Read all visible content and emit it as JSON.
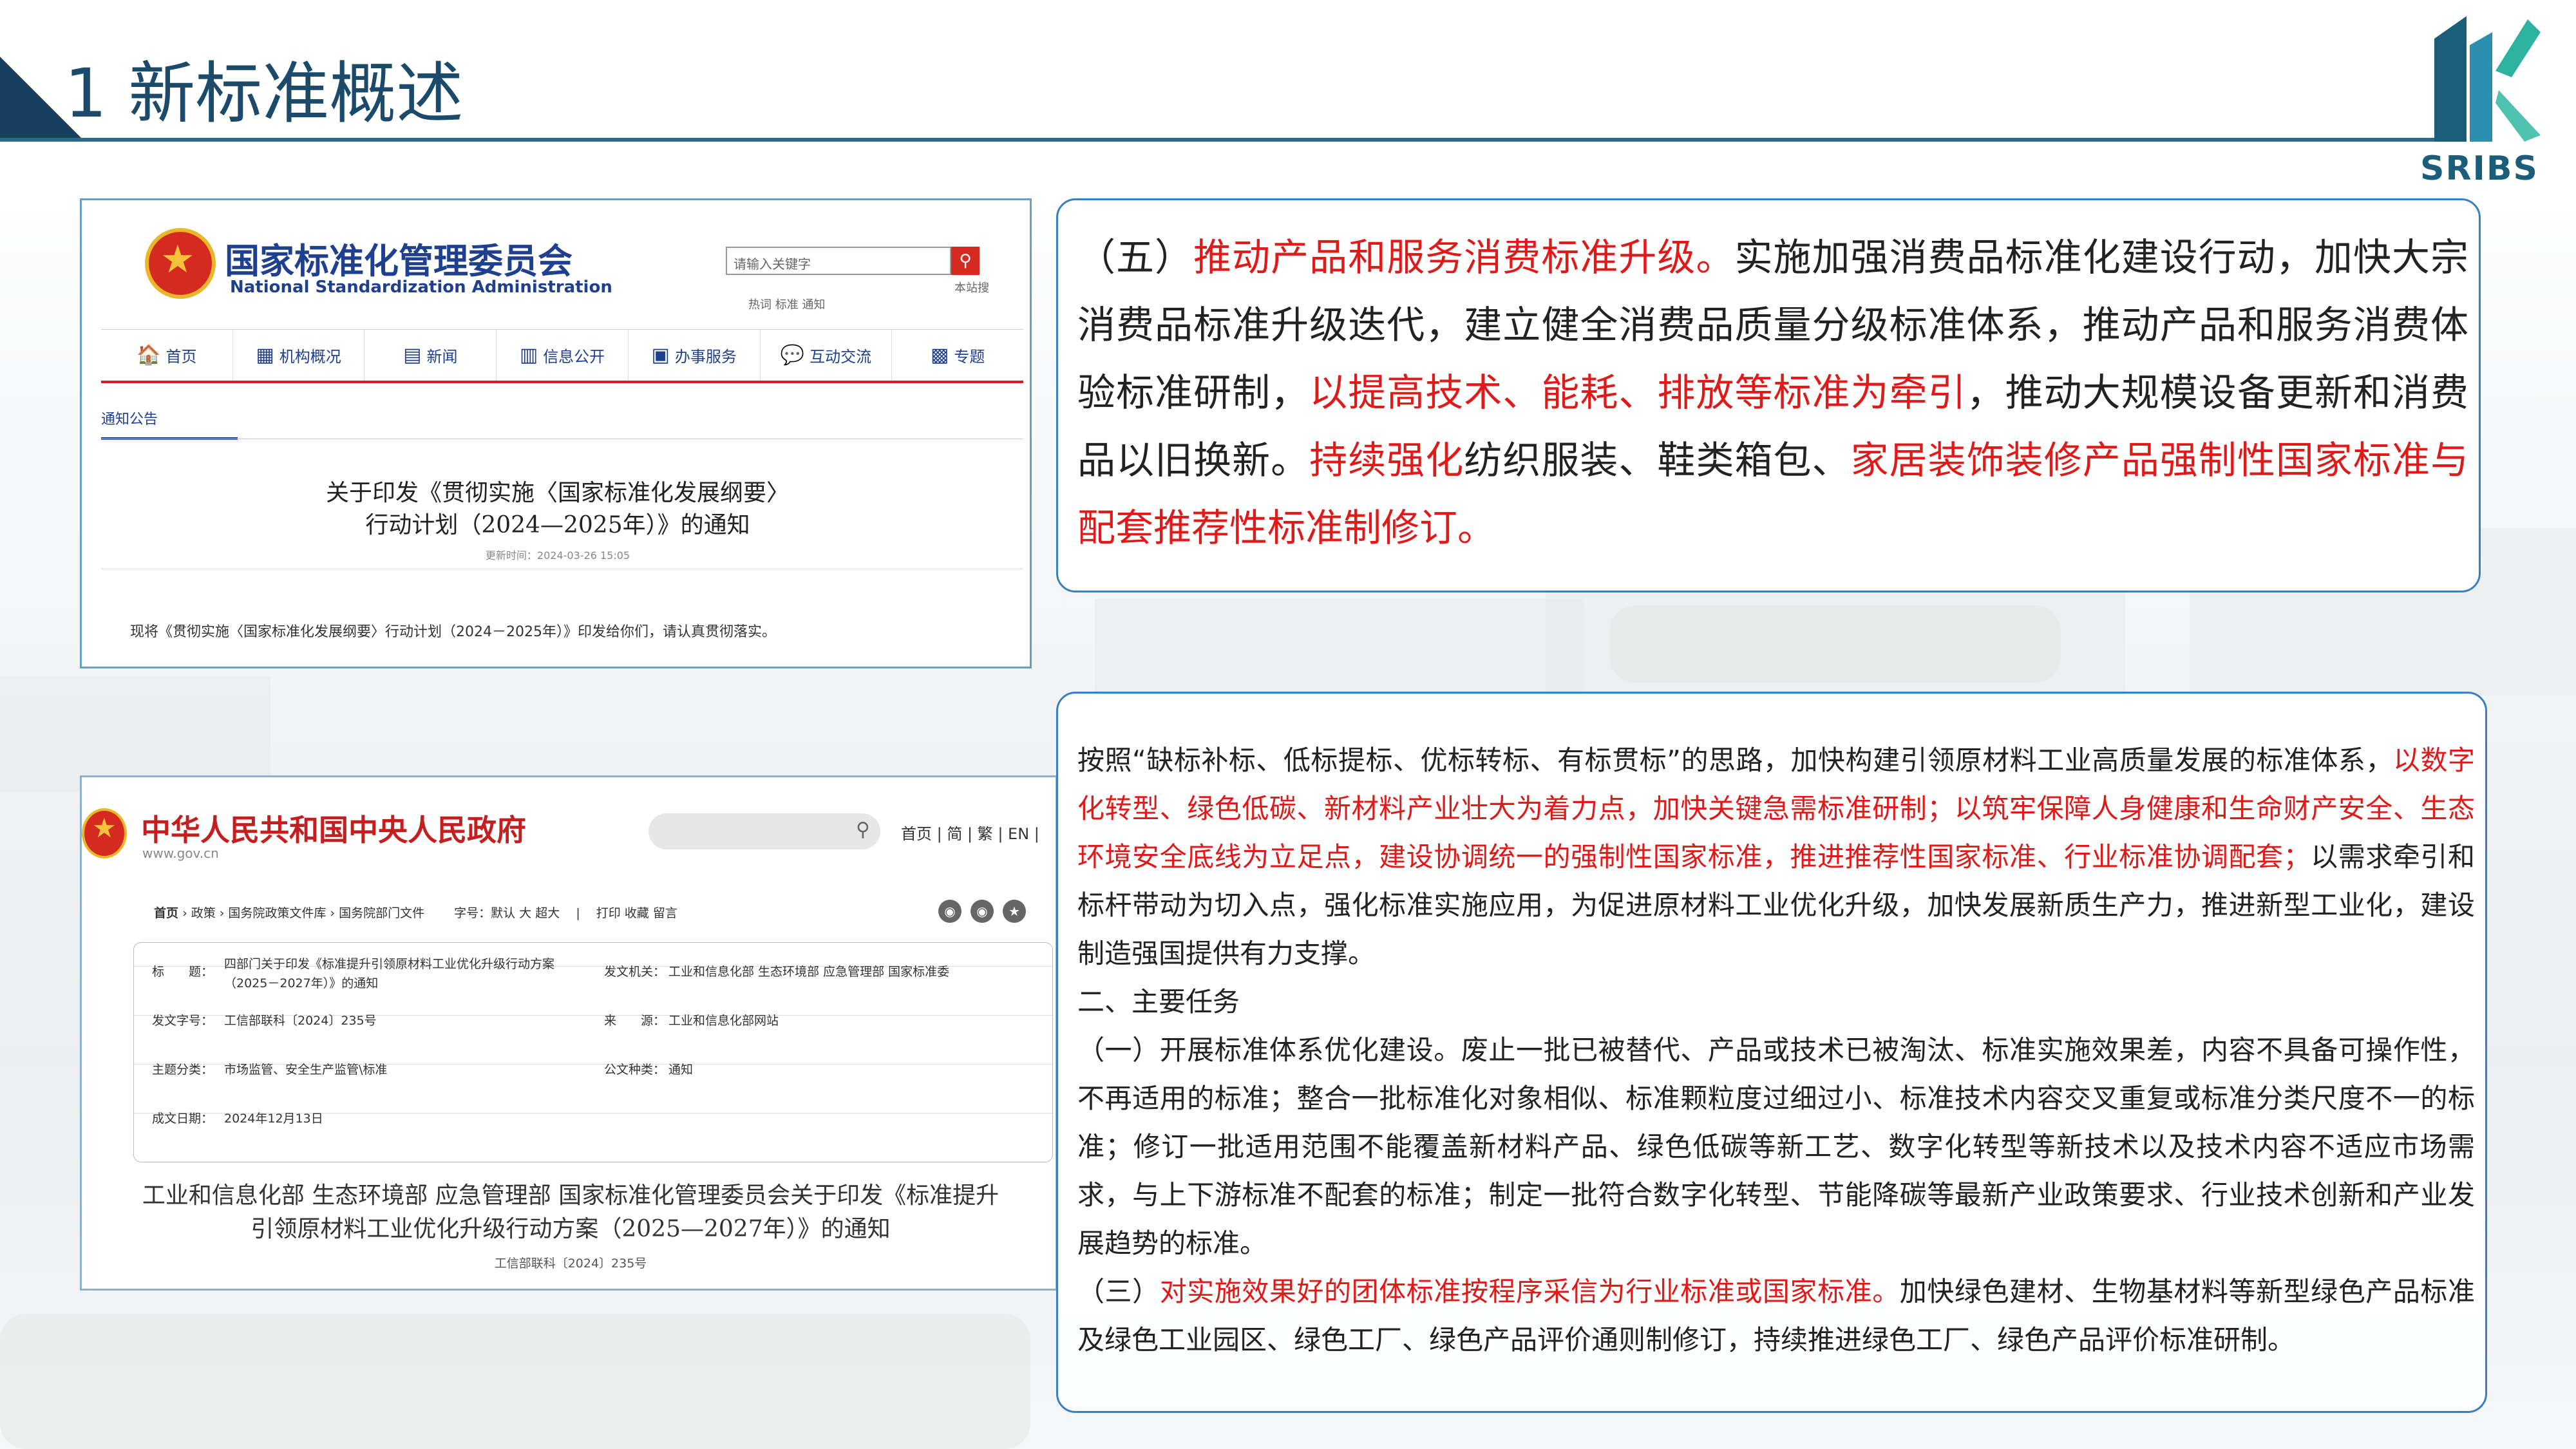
{
  "header": {
    "title": "1 新标准概述",
    "logo_text": "SRIBS"
  },
  "screenshot1": {
    "org_cn": "国家标准化管理委员会",
    "org_en": "National Standardization Administration",
    "search_placeholder": "请输入关键字",
    "search_hot": "热词  标准  通知",
    "site_search": "本站搜",
    "nav": [
      {
        "icon": "🏠",
        "label": "首页"
      },
      {
        "icon": "▦",
        "label": "机构概况"
      },
      {
        "icon": "▤",
        "label": "新闻"
      },
      {
        "icon": "▥",
        "label": "信息公开"
      },
      {
        "icon": "▣",
        "label": "办事服务"
      },
      {
        "icon": "💬",
        "label": "互动交流"
      },
      {
        "icon": "▩",
        "label": "专题"
      }
    ],
    "tab": "通知公告",
    "doc_title_1": "关于印发《贯彻实施〈国家标准化发展纲要〉",
    "doc_title_2": "行动计划（2024—2025年）》的通知",
    "updated": "更新时间：2024-03-26 15:05",
    "body": "现将《贯彻实施〈国家标准化发展纲要〉行动计划（2024－2025年）》印发给你们，请认真贯彻落实。"
  },
  "screenshot2": {
    "org_cn": "中华人民共和国中央人民政府",
    "url": "www.gov.cn",
    "links": "首页 | 简 | 繁 | EN |",
    "breadcrumb": [
      "首页",
      "政策",
      "国务院政策文件库",
      "国务院部门文件"
    ],
    "font_size": "字号：默认  大  超大",
    "actions": "打印  收藏  留言",
    "fields": {
      "title_label": "标　　题：",
      "title_value_1": "四部门关于印发《标准提升引领原材料工业优化升级行动方案",
      "title_value_2": "（2025－2027年）》的通知",
      "issuer_label": "发文机关：",
      "issuer_value": "工业和信息化部  生态环境部  应急管理部  国家标准委",
      "docno_label": "发文字号：",
      "docno_value": "工信部联科〔2024〕235号",
      "source_label": "来　　源：",
      "source_value": "工业和信息化部网站",
      "topic_label": "主题分类：",
      "topic_value": "市场监管、安全生产监管\\标准",
      "type_label": "公文种类：",
      "type_value": "通知",
      "date_label": "成文日期：",
      "date_value": "2024年12月13日"
    },
    "doc_title_1": "工业和信息化部 生态环境部 应急管理部 国家标准化管理委员会关于印发《标准提升",
    "doc_title_2": "引领原材料工业优化升级行动方案（2025—2027年）》的通知",
    "doc_no": "工信部联科〔2024〕235号"
  },
  "card1": {
    "t1": "（五）",
    "r1": "推动产品和服务消费标准升级。",
    "t2": "实施加强消费品标准化建设行动，加快大宗消费品标准升级迭代，建立健全消费品质量分级标准体系，推动产品和服务消费体验标准研制，",
    "r2": "以提高技术、能耗、排放等标准为牵引",
    "t3": "，推动大规模设备更新和消费品以旧换新。",
    "r3": "持续强化",
    "t4": "纺织服装、鞋类箱包、",
    "r4": "家居装饰装修产品强制性国家标准与配套推荐性标准制修订。"
  },
  "card2": {
    "p1_t1": "按照“缺标补标、低标提标、优标转标、有标贯标”的思路，加快构建引领原材料工业高质量发展的标准体系，",
    "p1_r1": "以数字化转型、绿色低碳、新材料产业壮大为着力点，加快关键急需标准研制；以筑牢保障人身健康和生命财产安全、生态环境安全底线为立足点，建设协调统一的强制性国家标准，推进推荐性国家标准、行业标准协调配套；",
    "p1_t2": "以需求牵引和标杆带动为切入点，强化标准实施应用，为促进原材料工业优化升级，加快发展新质生产力，推进新型工业化，建设制造强国提供有力支撑。",
    "p2": "二、主要任务",
    "p3": "（一）开展标准体系优化建设。废止一批已被替代、产品或技术已被淘汰、标准实施效果差，内容不具备可操作性，不再适用的标准；整合一批标准化对象相似、标准颗粒度过细过小、标准技术内容交叉重复或标准分类尺度不一的标准；修订一批适用范围不能覆盖新材料产品、绿色低碳等新工艺、数字化转型等新技术以及技术内容不适应市场需求，与上下游标准不配套的标准；制定一批符合数字化转型、节能降碳等最新产业政策要求、行业技术创新和产业发展趋势的标准。",
    "p4_t1": "（三）",
    "p4_r1": "对实施效果好的团体标准按程序采信为行业标准或国家标准。",
    "p4_t2": "加快绿色建材、生物基材料等新型绿色产品标准及绿色工业园区、绿色工厂、绿色产品评价通则制修订，持续推进绿色工厂、绿色产品评价标准研制。"
  }
}
